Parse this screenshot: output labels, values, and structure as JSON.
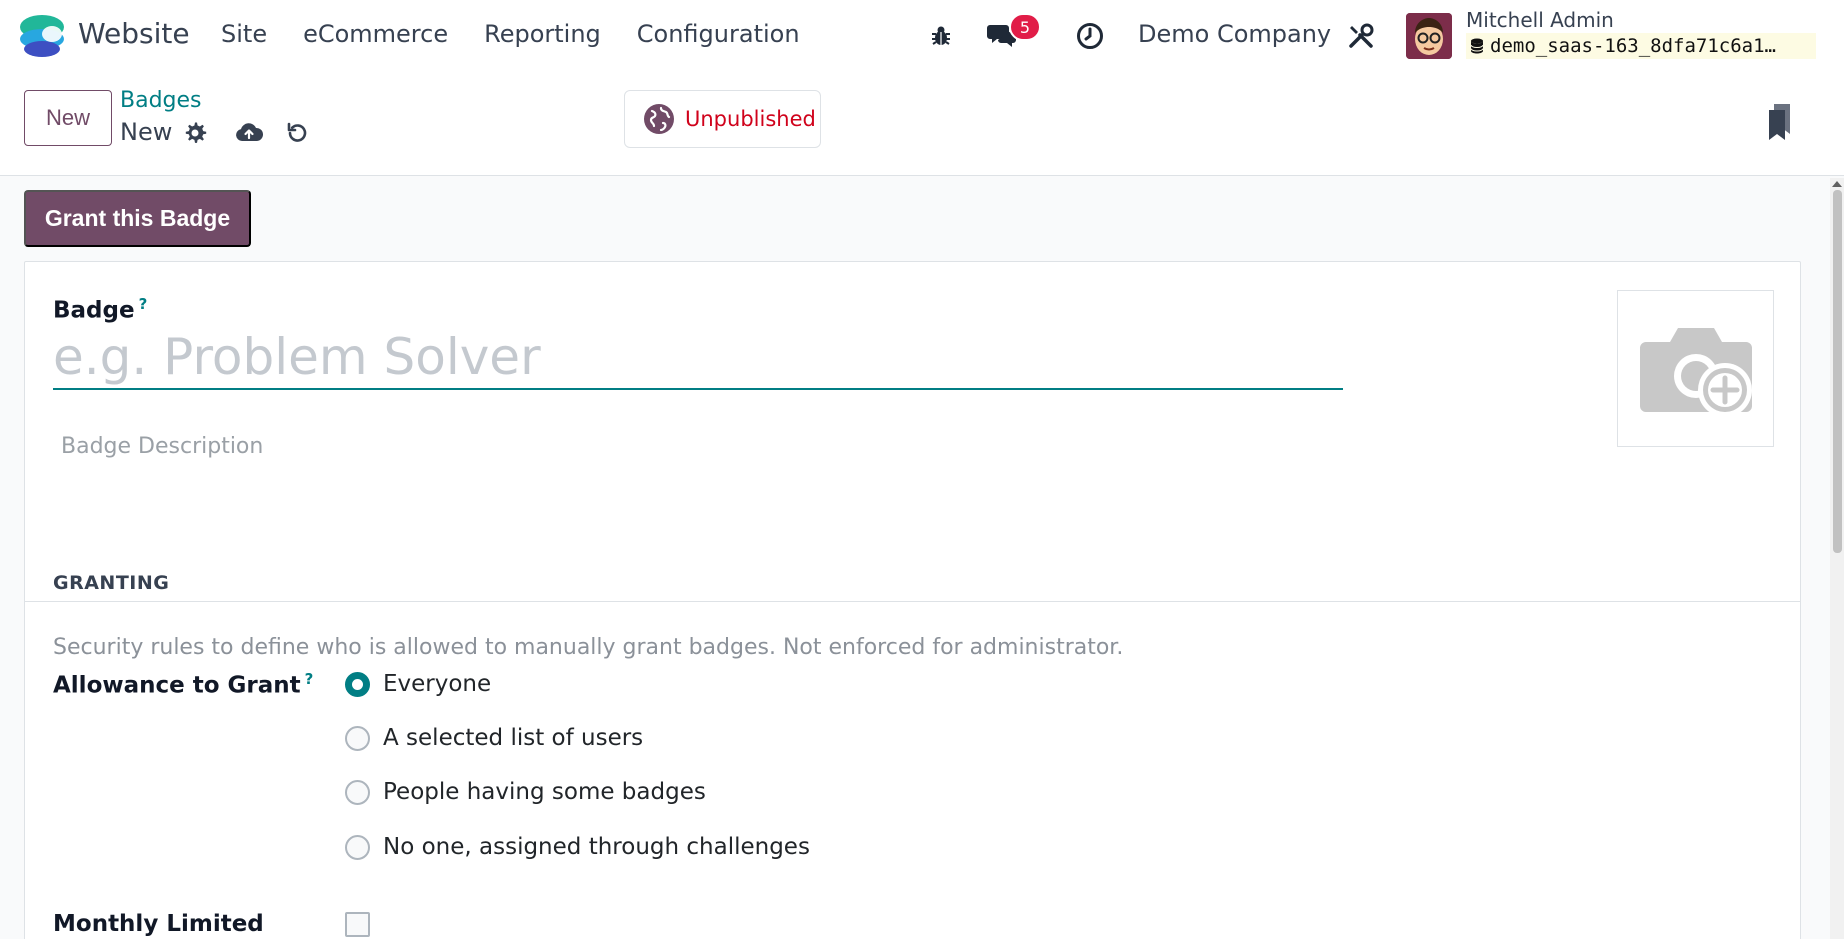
{
  "navbar": {
    "app_name": "Website",
    "menu": [
      "Site",
      "eCommerce",
      "Reporting",
      "Configuration"
    ],
    "message_count": "5",
    "company": "Demo Company",
    "user_name": "Mitchell Admin",
    "db_name": "demo_saas-163_8dfa71c6a1…"
  },
  "control_panel": {
    "new_label": "New",
    "breadcrumb_parent": "Badges",
    "breadcrumb_current": "New",
    "publish_status": "Unpublished"
  },
  "form": {
    "grant_button": "Grant this Badge",
    "badge_label": "Badge",
    "badge_help": "?",
    "badge_placeholder": "e.g. Problem Solver",
    "description_placeholder": "Badge Description",
    "section_granting": "GRANTING",
    "granting_help": "Security rules to define who is allowed to manually grant badges. Not enforced for administrator.",
    "allowance_label": "Allowance to Grant",
    "allowance_help": "?",
    "allowance_options": [
      "Everyone",
      "A selected list of users",
      "People having some badges",
      "No one, assigned through challenges"
    ],
    "allowance_selected": "Everyone",
    "monthly_limited_label": "Monthly Limited"
  },
  "colors": {
    "brand": "#714b67",
    "accent": "#017e84",
    "unpublished": "#d0021b",
    "badge": "#e11d48"
  }
}
